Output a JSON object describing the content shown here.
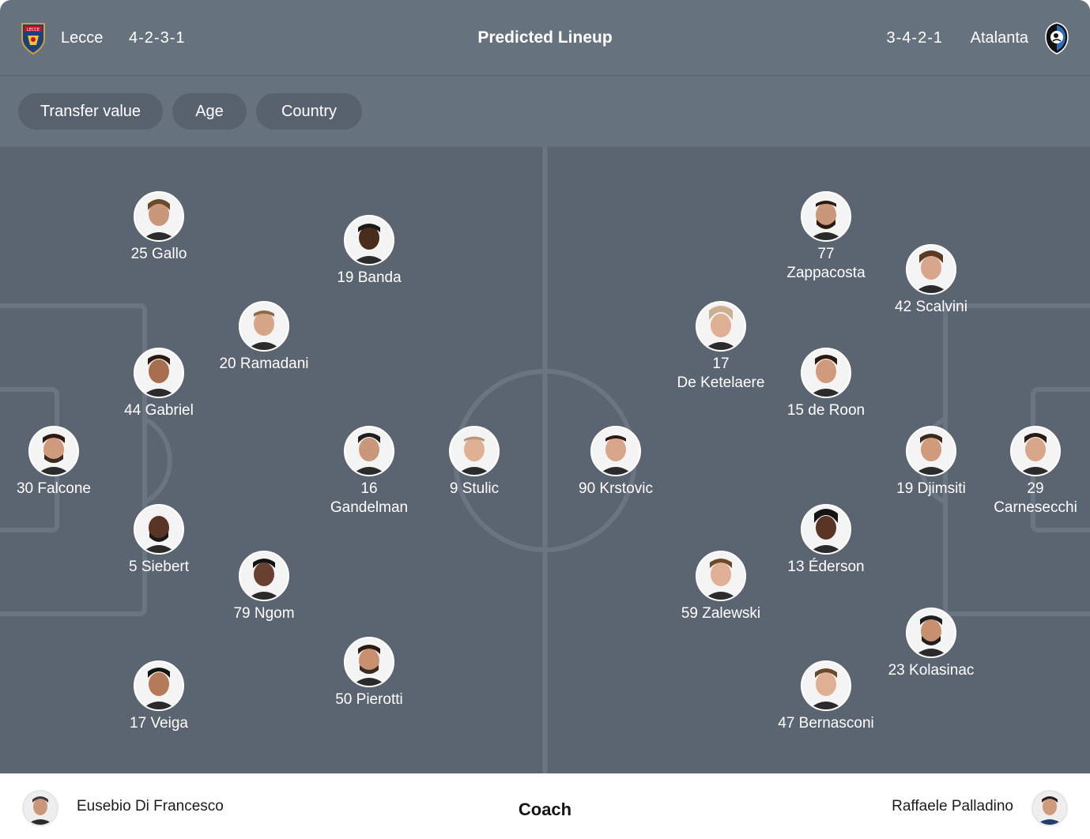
{
  "header": {
    "title": "Predicted Lineup",
    "home": {
      "name": "Lecce",
      "formation": "4-2-3-1",
      "logo_icon": "lecce-crest-icon"
    },
    "away": {
      "name": "Atalanta",
      "formation": "3-4-2-1",
      "logo_icon": "atalanta-crest-icon"
    }
  },
  "filters": [
    "Transfer value",
    "Age",
    "Country"
  ],
  "colors": {
    "header_bg": "#67727f",
    "chip_bg": "#58626e",
    "pitch_bg": "#5b6571",
    "pitch_lines": "#6b7581"
  },
  "players": {
    "home": [
      {
        "number": "25",
        "name": "Gallo"
      },
      {
        "number": "19",
        "name": "Banda"
      },
      {
        "number": "20",
        "name": "Ramadani"
      },
      {
        "number": "44",
        "name": "Gabriel"
      },
      {
        "number": "30",
        "name": "Falcone"
      },
      {
        "number": "16",
        "name": "Gandelman"
      },
      {
        "number": "9",
        "name": "Stulic"
      },
      {
        "number": "5",
        "name": "Siebert"
      },
      {
        "number": "79",
        "name": "Ngom"
      },
      {
        "number": "50",
        "name": "Pierotti"
      },
      {
        "number": "17",
        "name": "Veiga"
      }
    ],
    "away": [
      {
        "number": "77",
        "name": "Zappacosta"
      },
      {
        "number": "42",
        "name": "Scalvini"
      },
      {
        "number": "17",
        "name": "De Ketelaere"
      },
      {
        "number": "15",
        "name": "de Roon"
      },
      {
        "number": "90",
        "name": "Krstovic"
      },
      {
        "number": "19",
        "name": "Djimsiti"
      },
      {
        "number": "29",
        "name": "Carnesecchi"
      },
      {
        "number": "13",
        "name": "Éderson"
      },
      {
        "number": "59",
        "name": "Zalewski"
      },
      {
        "number": "23",
        "name": "Kolasinac"
      },
      {
        "number": "47",
        "name": "Bernasconi"
      }
    ]
  },
  "coach": {
    "label": "Coach",
    "home": "Eusebio Di Francesco",
    "away": "Raffaele Palladino"
  }
}
